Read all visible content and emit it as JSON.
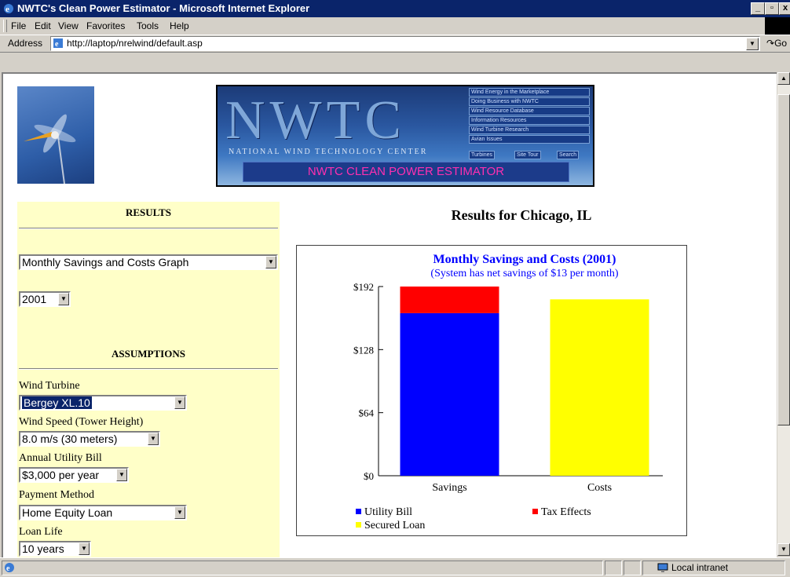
{
  "window": {
    "title": "NWTC's Clean Power Estimator - Microsoft Internet Explorer"
  },
  "menu": {
    "items": [
      "File",
      "Edit",
      "View",
      "Favorites",
      "Tools",
      "Help"
    ]
  },
  "address": {
    "label": "Address",
    "url": "http://laptop/nrelwind/default.asp",
    "go": "Go"
  },
  "banner": {
    "big": "NWTC",
    "sub": "NATIONAL WIND TECHNOLOGY CENTER",
    "menu": [
      "Wind Energy in the Marketplace",
      "Doing Business with NWTC",
      "Wind Resource Database",
      "Information Resources",
      "Wind Turbine Research",
      "Avian Issues"
    ],
    "small": [
      "Turbines",
      "Site Tour",
      "Search"
    ],
    "clean": "NWTC CLEAN POWER ESTIMATOR"
  },
  "left": {
    "results_head": "RESULTS",
    "report_select": "Monthly Savings and Costs Graph",
    "year_select": "2001",
    "assumptions_head": "ASSUMPTIONS",
    "fields": [
      {
        "label": "Wind Turbine",
        "value": "Bergey XL.10"
      },
      {
        "label": "Wind Speed (Tower Height)",
        "value": "8.0 m/s (30 meters)"
      },
      {
        "label": "Annual Utility Bill",
        "value": "$3,000 per year"
      },
      {
        "label": "Payment Method",
        "value": "Home Equity Loan"
      },
      {
        "label": "Loan Life",
        "value": "10 years"
      }
    ]
  },
  "results": {
    "title": "Results for Chicago, IL"
  },
  "chart_data": {
    "type": "bar",
    "title": "Monthly Savings and Costs (2001)",
    "subtitle": "(System has net savings of $13 per month)",
    "categories": [
      "Savings",
      "Costs"
    ],
    "series": [
      {
        "name": "Utility Bill",
        "color": "#0000ff",
        "values": [
          165,
          0
        ]
      },
      {
        "name": "Tax Effects",
        "color": "#ff0000",
        "values": [
          27,
          0
        ]
      },
      {
        "name": "Secured Loan",
        "color": "#ffff00",
        "values": [
          0,
          179
        ]
      }
    ],
    "stacked": true,
    "ylim": [
      0,
      192
    ],
    "yticks": [
      "$0",
      "$64",
      "$128",
      "$192"
    ],
    "ytick_values": [
      0,
      64,
      128,
      192
    ],
    "legend_position": "bottom"
  },
  "status": {
    "zone": "Local intranet"
  }
}
